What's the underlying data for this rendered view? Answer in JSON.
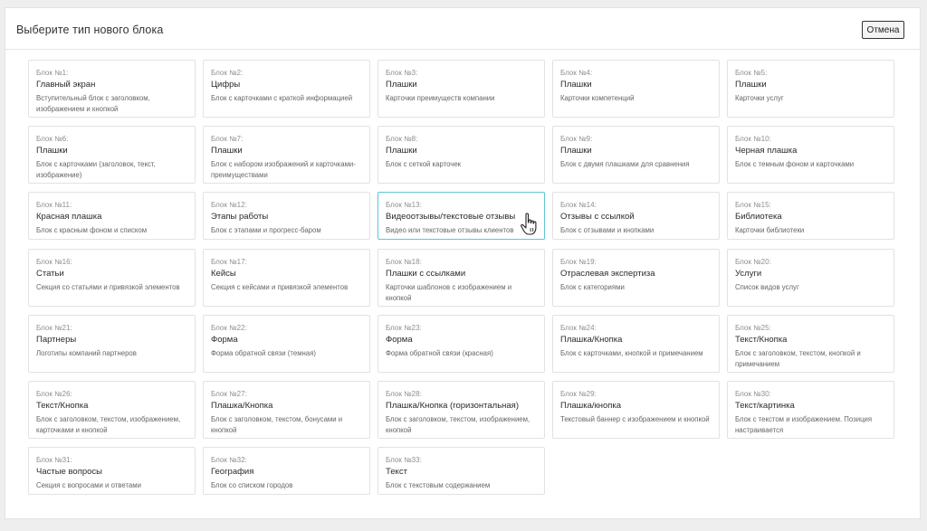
{
  "dialog": {
    "title": "Выберите тип нового блока",
    "cancel_label": "Отмена"
  },
  "blocks": [
    {
      "num": "Блок №1:",
      "name": "Главный экран",
      "desc": "Вступительный блок с заголовком, изображением и кнопкой"
    },
    {
      "num": "Блок №2:",
      "name": "Цифры",
      "desc": "Блок с карточками с краткой информацией"
    },
    {
      "num": "Блок №3:",
      "name": "Плашки",
      "desc": "Карточки преимуществ компании"
    },
    {
      "num": "Блок №4:",
      "name": "Плашки",
      "desc": "Карточки компетенций"
    },
    {
      "num": "Блок №5:",
      "name": "Плашки",
      "desc": "Карточки услуг"
    },
    {
      "num": "Блок №6:",
      "name": "Плашки",
      "desc": "Блок с карточками (заголовок, текст, изображение)"
    },
    {
      "num": "Блок №7:",
      "name": "Плашки",
      "desc": "Блок с набором изображений и карточками-преимуществами"
    },
    {
      "num": "Блок №8:",
      "name": "Плашки",
      "desc": "Блок с сеткой карточек"
    },
    {
      "num": "Блок №9:",
      "name": "Плашки",
      "desc": "Блок с двумя плашками для сравнения"
    },
    {
      "num": "Блок №10:",
      "name": "Черная плашка",
      "desc": "Блок с темным фоном и карточками"
    },
    {
      "num": "Блок №11:",
      "name": "Красная плашка",
      "desc": "Блок с красным фоном и списком"
    },
    {
      "num": "Блок №12:",
      "name": "Этапы работы",
      "desc": "Блок с этапами и прогресс-баром"
    },
    {
      "num": "Блок №13:",
      "name": "Видеоотзывы/текстовые отзывы",
      "desc": "Видео или текстовые отзывы клиентов"
    },
    {
      "num": "Блок №14:",
      "name": "Отзывы с ссылкой",
      "desc": "Блок с отзывами и кнопками"
    },
    {
      "num": "Блок №15:",
      "name": "Библиотека",
      "desc": "Карточки библиотеки"
    },
    {
      "num": "Блок №16:",
      "name": "Статьи",
      "desc": "Секция со статьями и привязкой элементов"
    },
    {
      "num": "Блок №17:",
      "name": "Кейсы",
      "desc": "Секция с кейсами и привязкой элементов"
    },
    {
      "num": "Блок №18:",
      "name": "Плашки с ссылками",
      "desc": "Карточки шаблонов с изображением и кнопкой"
    },
    {
      "num": "Блок №19:",
      "name": "Отраслевая экспертиза",
      "desc": "Блок с категориями"
    },
    {
      "num": "Блок №20:",
      "name": "Услуги",
      "desc": "Список видов услуг"
    },
    {
      "num": "Блок №21:",
      "name": "Партнеры",
      "desc": "Логотипы компаний партнеров"
    },
    {
      "num": "Блок №22:",
      "name": "Форма",
      "desc": "Форма обратной связи (темная)"
    },
    {
      "num": "Блок №23:",
      "name": "Форма",
      "desc": "Форма обратной связи (красная)"
    },
    {
      "num": "Блок №24:",
      "name": "Плашка/Кнопка",
      "desc": "Блок с карточками, кнопкой и примечанием"
    },
    {
      "num": "Блок №25:",
      "name": "Текст/Кнопка",
      "desc": "Блок с заголовком, текстом, кнопкой и примечанием"
    },
    {
      "num": "Блок №26:",
      "name": "Текст/Кнопка",
      "desc": "Блок с заголовком, текстом, изображением, карточками и кнопкой"
    },
    {
      "num": "Блок №27:",
      "name": "Плашка/Кнопка",
      "desc": "Блок с заголовком, текстом, бонусами и кнопкой"
    },
    {
      "num": "Блок №28:",
      "name": "Плашка/Кнопка (горизонтальная)",
      "desc": "Блок с заголовком, текстом, изображением, кнопкой"
    },
    {
      "num": "Блок №29:",
      "name": "Плашка/кнопка",
      "desc": "Текстовый баннер с изображением и кнопкой"
    },
    {
      "num": "Блок №30:",
      "name": "Текст/картинка",
      "desc": "Блок с текстом и изображением. Позиция настраивается"
    },
    {
      "num": "Блок №31:",
      "name": "Частые вопросы",
      "desc": "Секция с вопросами и ответами"
    },
    {
      "num": "Блок №32:",
      "name": "География",
      "desc": "Блок со списком городов"
    },
    {
      "num": "Блок №33:",
      "name": "Текст",
      "desc": "Блок с текстовым содержанием"
    }
  ],
  "colors": {
    "highlight_border": "#5ec6d6"
  },
  "cursor_icon": "hand-pointer-icon"
}
